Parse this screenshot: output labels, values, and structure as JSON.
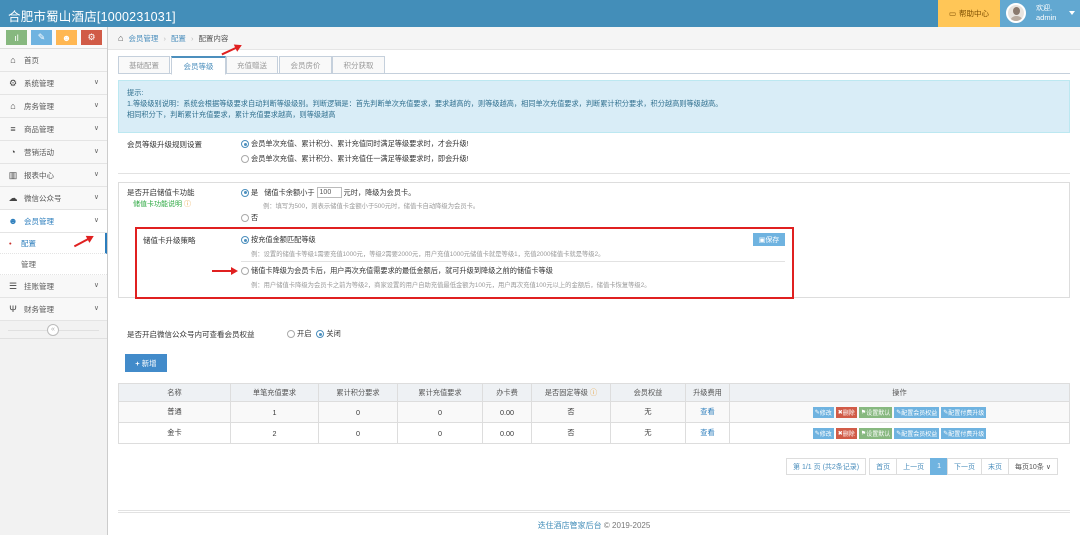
{
  "header": {
    "brand": "合肥市蜀山酒店[1000231031]",
    "help_label": "帮助中心",
    "user_welcome": "欢迎,",
    "user_name": "admin"
  },
  "sidebar": {
    "shortcut_colors": [
      "#87b87f",
      "#6fb3e0",
      "#ffb752",
      "#d15b47"
    ],
    "items": [
      {
        "label": "首页",
        "icon": "home-icon"
      },
      {
        "label": "系统管理",
        "icon": "gear-icon"
      },
      {
        "label": "房务管理",
        "icon": "bank-icon"
      },
      {
        "label": "商品管理",
        "icon": "database-icon"
      },
      {
        "label": "营销活动",
        "icon": "dashboard-icon"
      },
      {
        "label": "报表中心",
        "icon": "bar-chart-icon"
      },
      {
        "label": "微信公众号",
        "icon": "cloud-icon"
      },
      {
        "label": "会员管理",
        "icon": "users-icon"
      },
      {
        "label": "挂账管理",
        "icon": "list-icon"
      },
      {
        "label": "财务管理",
        "icon": "cutlery-icon"
      }
    ],
    "sub_items": [
      "配置",
      "管理"
    ]
  },
  "breadcrumb": [
    "会员管理",
    "配置",
    "配置内容"
  ],
  "tabs": [
    "基础配置",
    "会员等级",
    "充值赠送",
    "会员房价",
    "积分获取"
  ],
  "alert": {
    "title": "提示:",
    "line1": "1.等级级别说明：系统会根据等级要求自动判断等级级别。判断逻辑是：首先判断单次充值要求，要求越高的，则等级越高，相同单次充值要求，判断累计积分要求，积分越高则等级越高。",
    "line2": "相同积分下，判断累计充值要求，累计充值要求越高，则等级越高"
  },
  "upgrade_rule": {
    "label": "会员等级升级规则设置",
    "opt1": "会员单次充值、累计积分、累计充值同时满足等级要求时，才会升级!",
    "opt2": "会员单次充值、累计积分、累计充值任一满足等级要求时，即会升级!"
  },
  "stored_card": {
    "label": "是否开启储值卡功能",
    "help_link": "储值卡功能说明",
    "yes": "是",
    "yes_pre": "储值卡余额小于",
    "amount": "100",
    "yes_post": "元时，降级为会员卡。",
    "yes_hint": "例：填写为500，则表示储值卡金额小于500元时，储值卡自动降级为会员卡。",
    "no": "否",
    "strategy_label": "储值卡升级策略",
    "save": "保存",
    "s1": "按充值金额匹配等级",
    "s1_hint": "例：设置的储值卡等级1需要充值1000元，等级2需要2000元，用户充值1000元储值卡就是等级1，充值2000储值卡就是等级2。",
    "s2": "储值卡降级为会员卡后，用户再次充值需要求的最低金额后，就可升级到降级之前的储值卡等级",
    "s2_hint": "例：用户储值卡降级为会员卡之前为等级2，商家设置的用户自助充值最低金额为100元，用户再次充值100元以上的金额后，储值卡恢复等级2。"
  },
  "wechat": {
    "label": "是否开启微信公众号内可查看会员权益",
    "on": "开启",
    "off": "关闭"
  },
  "add_button": "新增",
  "table": {
    "headers": [
      "名称",
      "单笔充值要求",
      "累计积分要求",
      "累计充值要求",
      "办卡费",
      "是否固定等级",
      "会员权益",
      "升级费用",
      "操作"
    ],
    "rows": [
      {
        "name": "普通",
        "single": "1",
        "points": "0",
        "total": "0",
        "fee": "0.00",
        "fixed": "否",
        "rights": "无",
        "upgrade": "查看"
      },
      {
        "name": "金卡",
        "single": "2",
        "points": "0",
        "total": "0",
        "fee": "0.00",
        "fixed": "否",
        "rights": "无",
        "upgrade": "查看"
      }
    ],
    "ops": [
      "修改",
      "删除",
      "设置默认",
      "配置会员权益",
      "配置付费升级"
    ]
  },
  "pager": {
    "info": "第 1/1 页 (共2条记录)",
    "first": "首页",
    "prev": "上一页",
    "current": "1",
    "next": "下一页",
    "last": "末页",
    "per_page": "每页10条"
  },
  "footer": {
    "brand": "迭住酒店管家后台",
    "copy": "© 2019-2025"
  }
}
